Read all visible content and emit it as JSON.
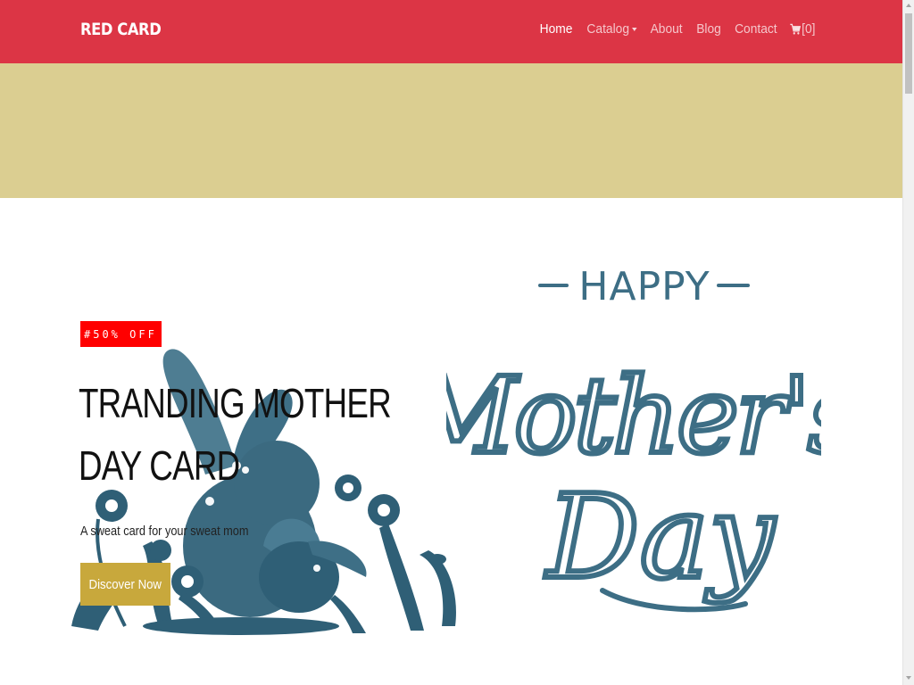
{
  "navbar": {
    "brand": "RED CARD",
    "background": "#dc3545",
    "items": [
      {
        "label": "Home",
        "active": true
      },
      {
        "label": "Catalog",
        "has_dropdown": true
      },
      {
        "label": "About"
      },
      {
        "label": "Blog"
      },
      {
        "label": "Contact"
      }
    ],
    "cart": {
      "icon": "cart-icon",
      "count_label": "[0]"
    }
  },
  "banner": {
    "color": "#dbce91"
  },
  "hero": {
    "badge": "#50% OFF",
    "title": "TRANDING MOTHER DAY CARD",
    "subtitle": "A sweat card for your sweat mom",
    "cta_label": "Discover Now",
    "cta_color": "#c8a83c",
    "illustration": "bunny-papercut-illustration",
    "lettering": {
      "line1": "HAPPY",
      "line2": "Mother's",
      "line3": "Day",
      "color": "#3d6e85"
    }
  }
}
